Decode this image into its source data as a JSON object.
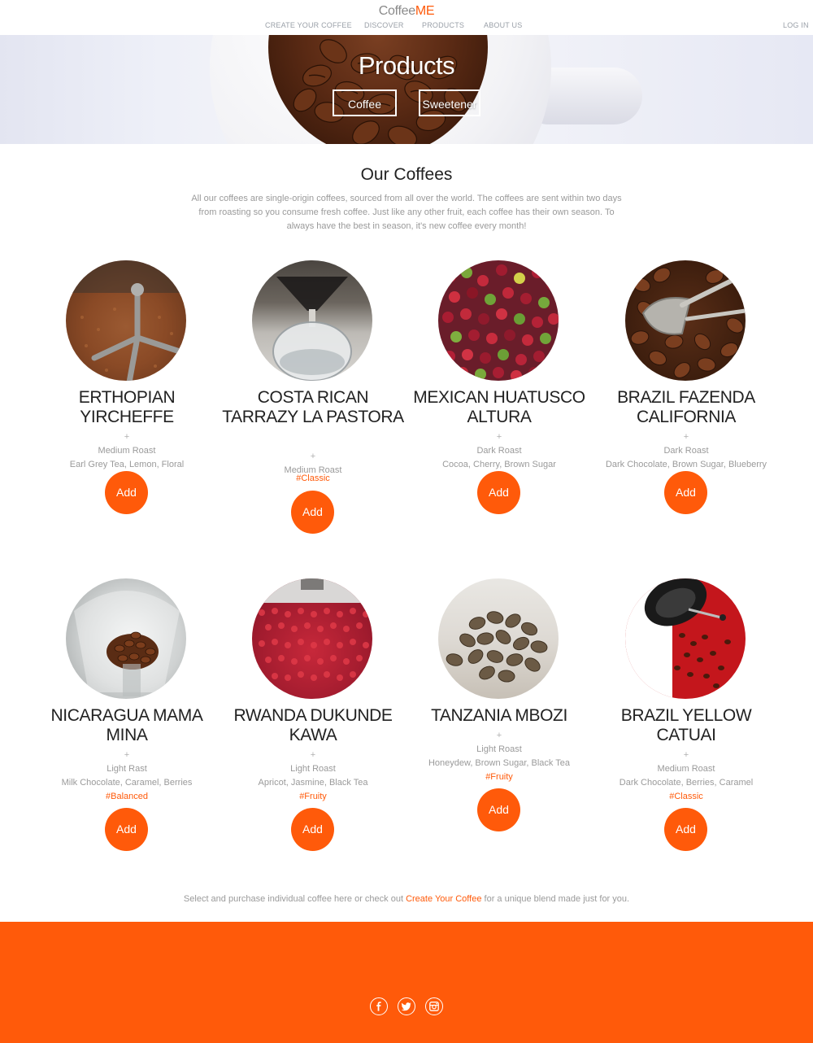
{
  "brand": {
    "prefix": "Coffee",
    "accent": "ME"
  },
  "nav": {
    "links": [
      "CREATE YOUR COFFEE",
      "DISCOVER",
      "PRODUCTS",
      "ABOUT US"
    ],
    "login": "LOG IN"
  },
  "hero": {
    "title": "Products",
    "buttons": [
      "Coffee",
      "Sweetener"
    ]
  },
  "intro": {
    "title": "Our Coffees",
    "text": "All our coffees are single-origin coffees, sourced from all over the world. The coffees are sent within two days from roasting so you consume fresh coffee. Just like any other fruit, each coffee has their own season. To always have the best in season, it's new coffee every month!"
  },
  "plus": "+",
  "add_label": "Add",
  "products": [
    {
      "name": "ERTHOPIAN YIRCHEFFE",
      "roast": "Medium Roast",
      "notes": "Earl Grey Tea, Lemon, Floral",
      "tag": ""
    },
    {
      "name": "COSTA RICAN TARRAZY LA PASTORA",
      "roast": "Medium Roast",
      "notes": "",
      "tag": "#Classic"
    },
    {
      "name": "MEXICAN HUATUSCO ALTURA",
      "roast": "Dark Roast",
      "notes": "Cocoa, Cherry, Brown Sugar",
      "tag": ""
    },
    {
      "name": "BRAZIL FAZENDA CALIFORNIA",
      "roast": "Dark Roast",
      "notes": "Dark Chocolate, Brown Sugar, Blueberry",
      "tag": ""
    },
    {
      "name": "NICARAGUA MAMA MINA",
      "roast": "Light Rast",
      "notes": "Milk Chocolate, Caramel, Berries",
      "tag": "#Balanced"
    },
    {
      "name": "RWANDA DUKUNDE KAWA",
      "roast": "Light Roast",
      "notes": "Apricot, Jasmine, Black Tea",
      "tag": "#Fruity"
    },
    {
      "name": "TANZANIA MBOZI",
      "roast": "Light Roast",
      "notes": "Honeydew, Brown Sugar, Black Tea",
      "tag": "#Fruity"
    },
    {
      "name": "BRAZIL YELLOW CATUAI",
      "roast": "Medium Roast",
      "notes": "Dark Chocolate, Berries, Caramel",
      "tag": "#Classic"
    }
  ],
  "footnote": {
    "before": "Select and purchase individual coffee here or check out",
    "link": "Create Your Coffee",
    "after": "for a unique blend made just for you."
  },
  "footer": {
    "social_icons": [
      "facebook-icon",
      "twitter-icon",
      "instagram-icon"
    ]
  },
  "colors": {
    "accent": "#ff5a0a",
    "muted_text": "#9a9a9a",
    "nav_text": "#9aa0a8"
  }
}
